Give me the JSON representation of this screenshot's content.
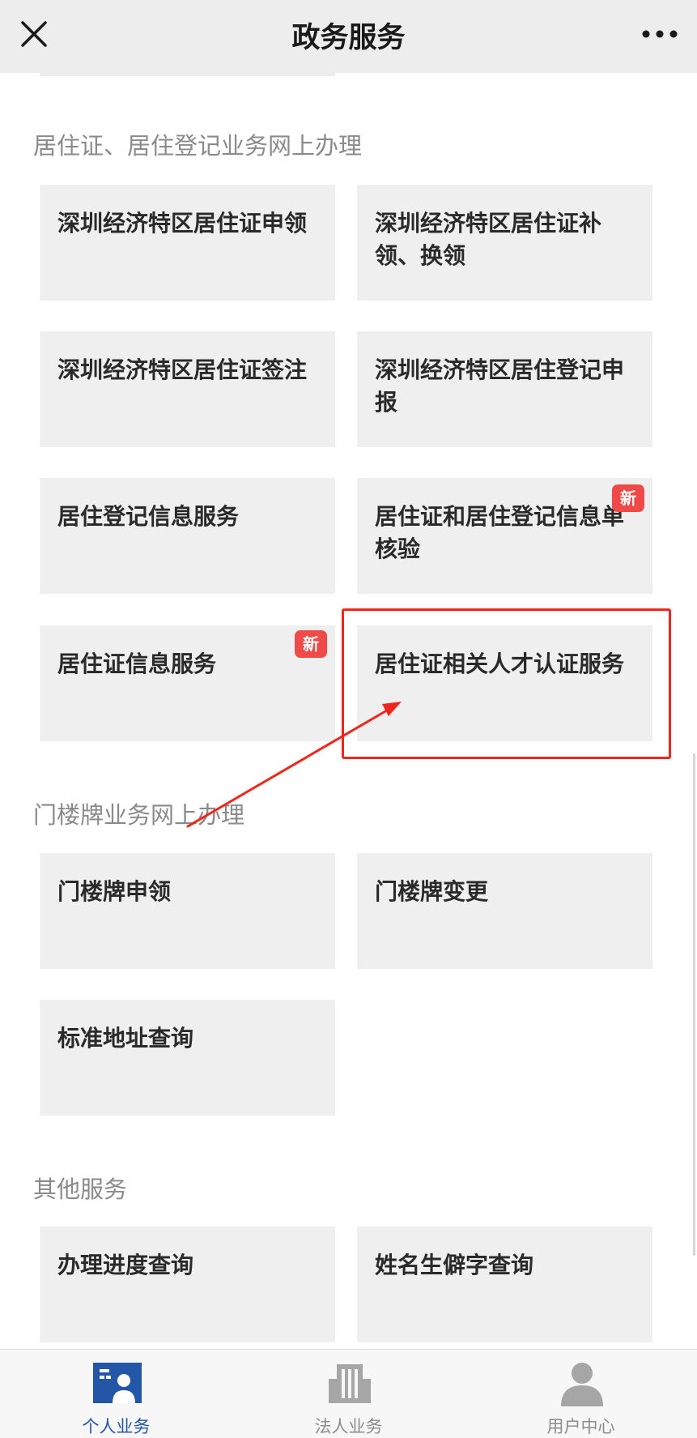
{
  "header": {
    "title": "政务服务"
  },
  "sections": [
    {
      "heading": "居住证、居住登记业务网上办理",
      "cards": [
        {
          "label": "深圳经济特区居住证申领",
          "badge": ""
        },
        {
          "label": "深圳经济特区居住证补领、换领",
          "badge": ""
        },
        {
          "label": "深圳经济特区居住证签注",
          "badge": ""
        },
        {
          "label": "深圳经济特区居住登记申报",
          "badge": ""
        },
        {
          "label": "居住登记信息服务",
          "badge": ""
        },
        {
          "label": "居住证和居住登记信息单核验",
          "badge": "新"
        },
        {
          "label": "居住证信息服务",
          "badge": "新"
        },
        {
          "label": "居住证相关人才认证服务",
          "badge": ""
        }
      ]
    },
    {
      "heading": "门楼牌业务网上办理",
      "cards": [
        {
          "label": "门楼牌申领",
          "badge": ""
        },
        {
          "label": "门楼牌变更",
          "badge": ""
        },
        {
          "label": "标准地址查询",
          "badge": ""
        }
      ]
    },
    {
      "heading": "其他服务",
      "cards": [
        {
          "label": "办理进度查询",
          "badge": ""
        },
        {
          "label": "姓名生僻字查询",
          "badge": ""
        }
      ]
    }
  ],
  "tabbar": {
    "tabs": [
      {
        "label": "个人业务",
        "icon": "person-card-icon",
        "active": true
      },
      {
        "label": "法人业务",
        "icon": "building-icon",
        "active": false
      },
      {
        "label": "用户中心",
        "icon": "user-icon",
        "active": false
      }
    ]
  },
  "colors": {
    "accent": "#2356a6",
    "badge": "#f04a48",
    "annotation": "#f0261d",
    "card_bg": "#efefef",
    "header_bg": "#ededed"
  }
}
